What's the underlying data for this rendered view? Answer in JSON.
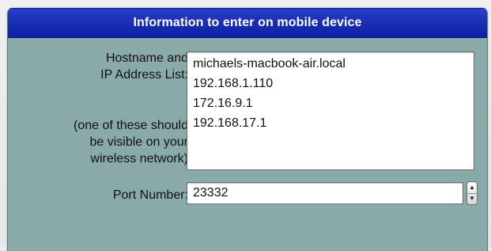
{
  "dialog": {
    "title": "Information to enter on mobile device"
  },
  "host_section": {
    "label": "Hostname and\nIP Address List:",
    "hint": "(one of these should\nbe visible on your\nwireless network)",
    "addresses": [
      "michaels-macbook-air.local",
      "192.168.1.110",
      "172.16.9.1",
      "192.168.17.1"
    ]
  },
  "port_section": {
    "label": "Port Number:",
    "value": "23332"
  },
  "icons": {
    "stepper_up": "triangle-up-icon",
    "stepper_down": "triangle-down-icon"
  },
  "colors": {
    "title_bar": "#1a2fb4",
    "panel_background": "#8aaaa9",
    "title_text": "#ffffff"
  }
}
